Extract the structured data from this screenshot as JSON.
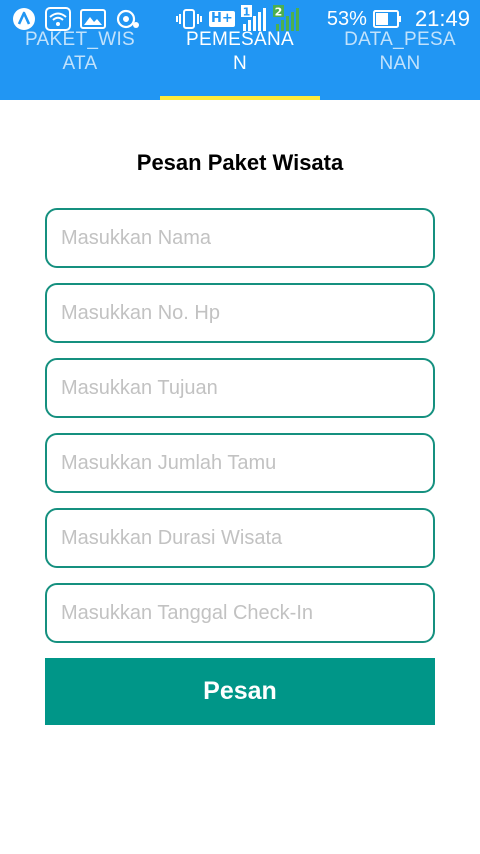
{
  "status_bar": {
    "battery_percent": "53%",
    "time": "21:49",
    "network_type": "H+",
    "sim1_label": "1",
    "sim2_label": "2",
    "icons": [
      "app-a-icon",
      "wifi-icon",
      "gallery-icon",
      "sync-icon",
      "vibrate-icon",
      "network-type-icon",
      "signal-sim1-icon",
      "signal-sim2-icon",
      "battery-icon"
    ]
  },
  "tabs": [
    {
      "label": "PAKET_WISATA",
      "active": false
    },
    {
      "label": "PEMESANAN",
      "active": true
    },
    {
      "label": "DATA_PESANAN",
      "active": false
    }
  ],
  "colors": {
    "app_bar": "#2196F3",
    "tab_indicator": "#FFEB3B",
    "field_border": "#15907f",
    "button": "#009688"
  },
  "form": {
    "title": "Pesan Paket Wisata",
    "fields": [
      {
        "placeholder": "Masukkan Nama",
        "value": ""
      },
      {
        "placeholder": "Masukkan No. Hp",
        "value": ""
      },
      {
        "placeholder": "Masukkan Tujuan",
        "value": ""
      },
      {
        "placeholder": "Masukkan Jumlah Tamu",
        "value": ""
      },
      {
        "placeholder": "Masukkan Durasi Wisata",
        "value": ""
      },
      {
        "placeholder": "Masukkan Tanggal Check-In",
        "value": ""
      }
    ],
    "submit_label": "Pesan"
  }
}
